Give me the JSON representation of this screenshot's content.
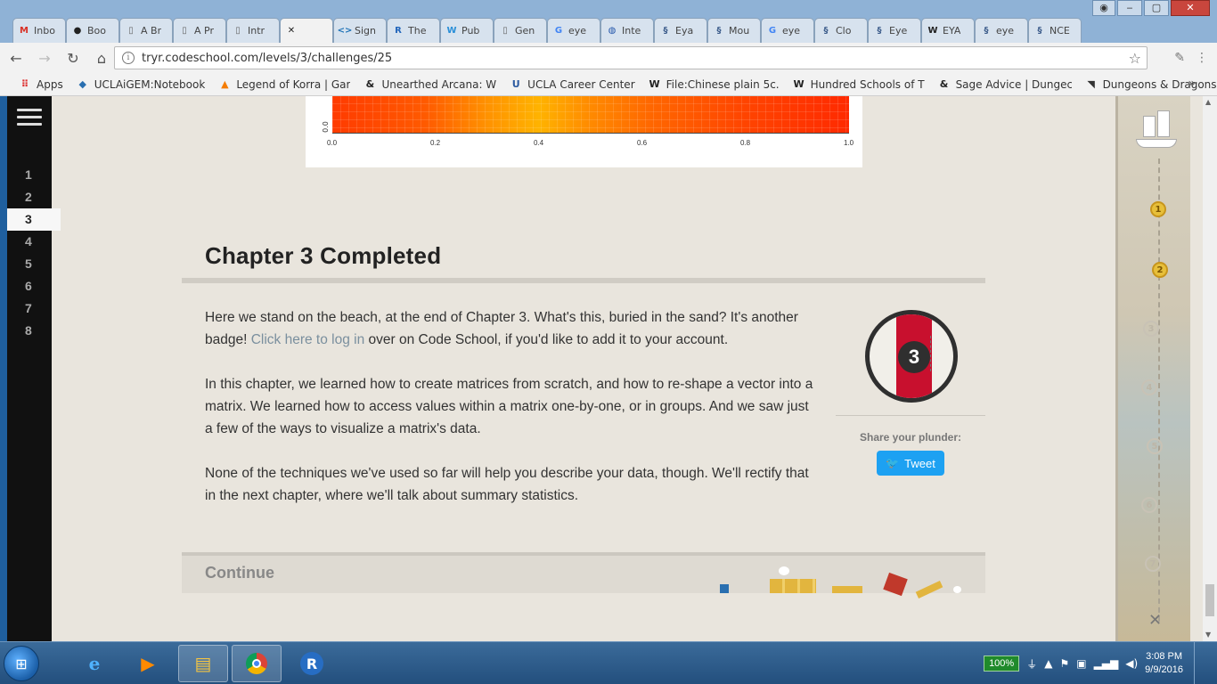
{
  "browser": {
    "tabs": [
      {
        "label": "Inbo",
        "icon": "gmail-icon",
        "glyph": "M",
        "color": "#d93025"
      },
      {
        "label": "Boo",
        "icon": "github-icon",
        "glyph": "●",
        "color": "#222222"
      },
      {
        "label": "A Br",
        "icon": "document-icon",
        "glyph": "▯",
        "color": "#666666"
      },
      {
        "label": "A Pr",
        "icon": "document-icon",
        "glyph": "▯",
        "color": "#666666"
      },
      {
        "label": "Intr",
        "icon": "document-icon",
        "glyph": "▯",
        "color": "#666666"
      },
      {
        "label": "",
        "icon": "codeschool-icon",
        "glyph": "✕",
        "color": "#222222",
        "active": true
      },
      {
        "label": "Sign",
        "icon": "code-icon",
        "glyph": "<>",
        "color": "#1f73b7"
      },
      {
        "label": "The",
        "icon": "r-icon",
        "glyph": "R",
        "color": "#2266bb"
      },
      {
        "label": "Pub",
        "icon": "w-icon",
        "glyph": "W",
        "color": "#2a8fd8"
      },
      {
        "label": "Gen",
        "icon": "document-icon",
        "glyph": "▯",
        "color": "#666666"
      },
      {
        "label": "eye",
        "icon": "google-icon",
        "glyph": "G",
        "color": "#4285f4"
      },
      {
        "label": "Inte",
        "icon": "globe-icon",
        "glyph": "◍",
        "color": "#2255aa"
      },
      {
        "label": "Eya",
        "icon": "ncbi-icon",
        "glyph": "§",
        "color": "#3b5b8a"
      },
      {
        "label": "Mou",
        "icon": "ncbi-icon",
        "glyph": "§",
        "color": "#3b5b8a"
      },
      {
        "label": "eye",
        "icon": "google-icon",
        "glyph": "G",
        "color": "#4285f4"
      },
      {
        "label": "Clo",
        "icon": "ncbi-icon",
        "glyph": "§",
        "color": "#3b5b8a"
      },
      {
        "label": "Eye",
        "icon": "ncbi-icon",
        "glyph": "§",
        "color": "#3b5b8a"
      },
      {
        "label": "EYA",
        "icon": "wikipedia-icon",
        "glyph": "W",
        "color": "#222222"
      },
      {
        "label": "eye",
        "icon": "ncbi-icon",
        "glyph": "§",
        "color": "#3b5b8a"
      },
      {
        "label": "NCE",
        "icon": "ncbi-icon",
        "glyph": "§",
        "color": "#3b5b8a"
      }
    ],
    "url": "tryr.codeschool.com/levels/3/challenges/25",
    "bookmarks": [
      {
        "label": "Apps",
        "icon": "apps-grid-icon",
        "glyph": "⠿",
        "color": "#d33"
      },
      {
        "label": "UCLAiGEM:Notebook",
        "icon": "igem-icon",
        "glyph": "◆",
        "color": "#2a6fb0"
      },
      {
        "label": "Legend of Korra | Gar",
        "icon": "fandom-icon",
        "glyph": "▲",
        "color": "#f57c00"
      },
      {
        "label": "Unearthed Arcana: W",
        "icon": "dnd-icon",
        "glyph": "&",
        "color": "#222222"
      },
      {
        "label": "UCLA Career Center",
        "icon": "ucla-icon",
        "glyph": "U",
        "color": "#2c5aa0"
      },
      {
        "label": "File:Chinese plain 5c.",
        "icon": "wikipedia-icon",
        "glyph": "W",
        "color": "#222222"
      },
      {
        "label": "Hundred Schools of T",
        "icon": "wikipedia-icon",
        "glyph": "W",
        "color": "#222222"
      },
      {
        "label": "Sage Advice | Dungec",
        "icon": "dnd-icon",
        "glyph": "&",
        "color": "#222222"
      },
      {
        "label": "Dungeons & Dragons",
        "icon": "dragon-icon",
        "glyph": "◥",
        "color": "#333333"
      }
    ]
  },
  "sidebar": {
    "chapters": [
      "1",
      "2",
      "3",
      "4",
      "5",
      "6",
      "7",
      "8"
    ],
    "active_chapter": "3"
  },
  "plot": {
    "y_tick": "0.0",
    "x_ticks": [
      "0.0",
      "0.2",
      "0.4",
      "0.6",
      "0.8",
      "1.0"
    ]
  },
  "chapter": {
    "title": "Chapter 3 Completed",
    "para1_before": "Here we stand on the beach, at the end of Chapter 3. What's this, buried in the sand? It's another badge! ",
    "para1_link": "Click here to log in",
    "para1_after": " over on Code School, if you'd like to add it to your account.",
    "para2": "In this chapter, we learned how to create matrices from scratch, and how to re-shape a vector into a matrix. We learned how to access values within a matrix one-by-one, or in groups. And we saw just a few of the ways to visualize a matrix's data.",
    "para3": "None of the techniques we've used so far will help you describe your data, though. We'll rectify that in the next chapter, where we'll talk about summary statistics.",
    "badge_number": "3",
    "share_label": "Share your plunder:",
    "tweet_label": "Tweet",
    "continue_label": "Continue"
  },
  "map": {
    "nodes": [
      "1",
      "2",
      "3",
      "4",
      "5",
      "6",
      "7"
    ],
    "completed": [
      "1",
      "2"
    ]
  },
  "taskbar": {
    "battery": "100%",
    "time": "3:08 PM",
    "date": "9/9/2016"
  }
}
